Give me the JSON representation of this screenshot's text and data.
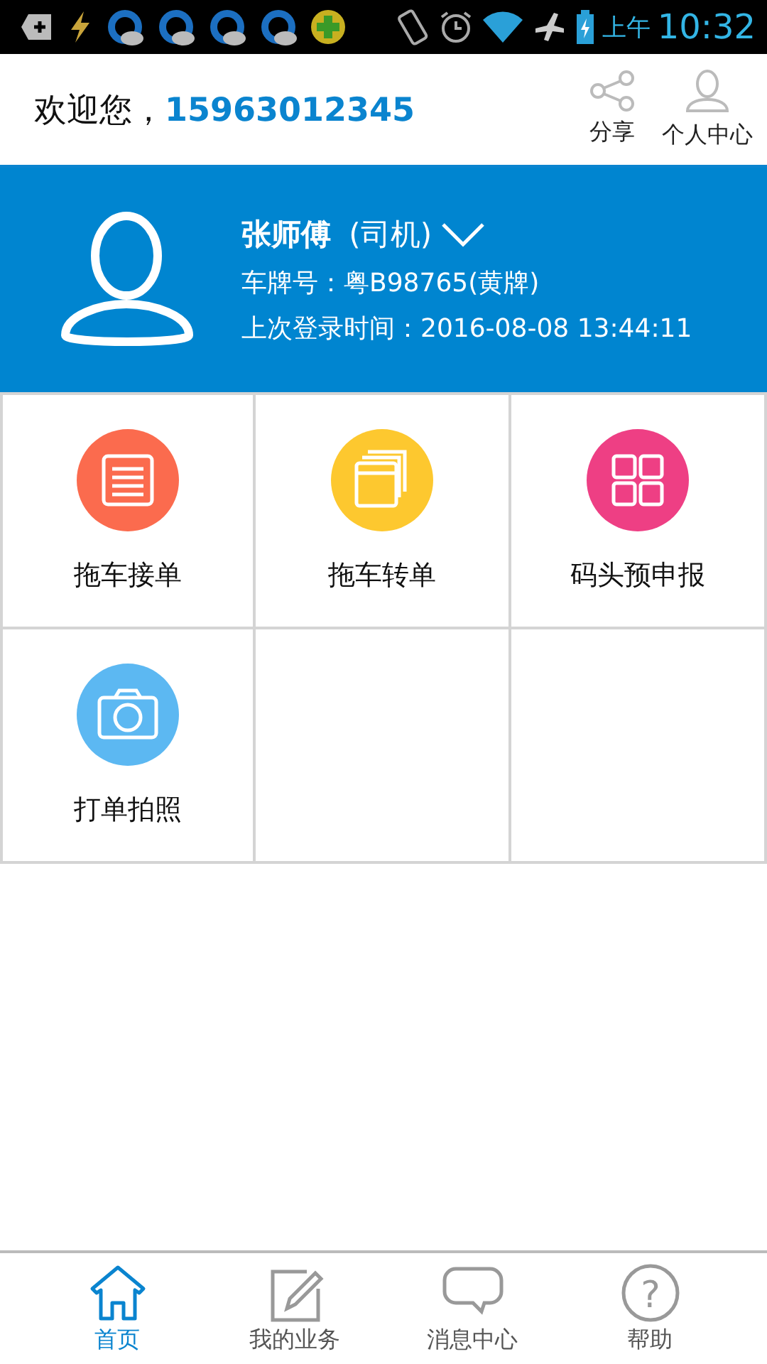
{
  "status_bar": {
    "period": "上午",
    "time": "10:32"
  },
  "header": {
    "greeting": "欢迎您，",
    "phone": "15963012345",
    "actions": [
      {
        "kind": "share",
        "label": "分享"
      },
      {
        "kind": "person",
        "label": "个人中心"
      }
    ]
  },
  "profile": {
    "name": "张师傅",
    "role": "(司机)",
    "plate": "车牌号：粤B98765(黄牌)",
    "last_login": "上次登录时间：2016-08-08 13:44:11"
  },
  "grid": [
    {
      "kind": "list",
      "label": "拖车接单",
      "color": "#fb6b4e"
    },
    {
      "kind": "pages",
      "label": "拖车转单",
      "color": "#fdc82f"
    },
    {
      "kind": "tiles",
      "label": "码头预申报",
      "color": "#ee3f84"
    },
    {
      "kind": "camera",
      "label": "打单拍照",
      "color": "#5cb8f2"
    }
  ],
  "nav": [
    {
      "kind": "home",
      "label": "首页",
      "selected": true
    },
    {
      "kind": "edit",
      "label": "我的业务",
      "selected": false
    },
    {
      "kind": "chat",
      "label": "消息中心",
      "selected": false
    },
    {
      "kind": "help",
      "label": "帮助",
      "selected": false,
      "glyph": "?"
    }
  ]
}
